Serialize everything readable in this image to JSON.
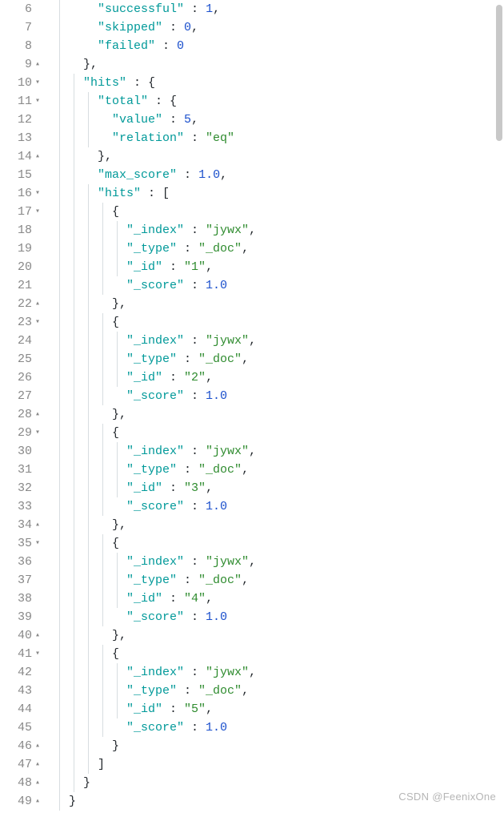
{
  "watermark": "CSDN @FeenixOne",
  "lines": [
    {
      "num": "6",
      "fold": "",
      "indent": 3,
      "parts": [
        [
          "k",
          "\"successful\""
        ],
        [
          "p",
          " : "
        ],
        [
          "n",
          "1"
        ],
        [
          "p",
          ","
        ]
      ]
    },
    {
      "num": "7",
      "fold": "",
      "indent": 3,
      "parts": [
        [
          "k",
          "\"skipped\""
        ],
        [
          "p",
          " : "
        ],
        [
          "n",
          "0"
        ],
        [
          "p",
          ","
        ]
      ]
    },
    {
      "num": "8",
      "fold": "",
      "indent": 3,
      "parts": [
        [
          "k",
          "\"failed\""
        ],
        [
          "p",
          " : "
        ],
        [
          "n",
          "0"
        ]
      ]
    },
    {
      "num": "9",
      "fold": "▴",
      "indent": 2,
      "parts": [
        [
          "p",
          "},"
        ]
      ]
    },
    {
      "num": "10",
      "fold": "▾",
      "indent": 2,
      "parts": [
        [
          "k",
          "\"hits\""
        ],
        [
          "p",
          " : {"
        ]
      ]
    },
    {
      "num": "11",
      "fold": "▾",
      "indent": 3,
      "parts": [
        [
          "k",
          "\"total\""
        ],
        [
          "p",
          " : {"
        ]
      ]
    },
    {
      "num": "12",
      "fold": "",
      "indent": 4,
      "parts": [
        [
          "k",
          "\"value\""
        ],
        [
          "p",
          " : "
        ],
        [
          "n",
          "5"
        ],
        [
          "p",
          ","
        ]
      ]
    },
    {
      "num": "13",
      "fold": "",
      "indent": 4,
      "parts": [
        [
          "k",
          "\"relation\""
        ],
        [
          "p",
          " : "
        ],
        [
          "s",
          "\"eq\""
        ]
      ]
    },
    {
      "num": "14",
      "fold": "▴",
      "indent": 3,
      "parts": [
        [
          "p",
          "},"
        ]
      ]
    },
    {
      "num": "15",
      "fold": "",
      "indent": 3,
      "parts": [
        [
          "k",
          "\"max_score\""
        ],
        [
          "p",
          " : "
        ],
        [
          "n",
          "1.0"
        ],
        [
          "p",
          ","
        ]
      ]
    },
    {
      "num": "16",
      "fold": "▾",
      "indent": 3,
      "parts": [
        [
          "k",
          "\"hits\""
        ],
        [
          "p",
          " : ["
        ]
      ]
    },
    {
      "num": "17",
      "fold": "▾",
      "indent": 4,
      "parts": [
        [
          "p",
          "{"
        ]
      ]
    },
    {
      "num": "18",
      "fold": "",
      "indent": 5,
      "parts": [
        [
          "k",
          "\"_index\""
        ],
        [
          "p",
          " : "
        ],
        [
          "s",
          "\"jywx\""
        ],
        [
          "p",
          ","
        ]
      ]
    },
    {
      "num": "19",
      "fold": "",
      "indent": 5,
      "parts": [
        [
          "k",
          "\"_type\""
        ],
        [
          "p",
          " : "
        ],
        [
          "s",
          "\"_doc\""
        ],
        [
          "p",
          ","
        ]
      ]
    },
    {
      "num": "20",
      "fold": "",
      "indent": 5,
      "parts": [
        [
          "k",
          "\"_id\""
        ],
        [
          "p",
          " : "
        ],
        [
          "s",
          "\"1\""
        ],
        [
          "p",
          ","
        ]
      ]
    },
    {
      "num": "21",
      "fold": "",
      "indent": 5,
      "parts": [
        [
          "k",
          "\"_score\""
        ],
        [
          "p",
          " : "
        ],
        [
          "n",
          "1.0"
        ]
      ]
    },
    {
      "num": "22",
      "fold": "▴",
      "indent": 4,
      "parts": [
        [
          "p",
          "},"
        ]
      ]
    },
    {
      "num": "23",
      "fold": "▾",
      "indent": 4,
      "parts": [
        [
          "p",
          "{"
        ]
      ]
    },
    {
      "num": "24",
      "fold": "",
      "indent": 5,
      "parts": [
        [
          "k",
          "\"_index\""
        ],
        [
          "p",
          " : "
        ],
        [
          "s",
          "\"jywx\""
        ],
        [
          "p",
          ","
        ]
      ]
    },
    {
      "num": "25",
      "fold": "",
      "indent": 5,
      "parts": [
        [
          "k",
          "\"_type\""
        ],
        [
          "p",
          " : "
        ],
        [
          "s",
          "\"_doc\""
        ],
        [
          "p",
          ","
        ]
      ]
    },
    {
      "num": "26",
      "fold": "",
      "indent": 5,
      "parts": [
        [
          "k",
          "\"_id\""
        ],
        [
          "p",
          " : "
        ],
        [
          "s",
          "\"2\""
        ],
        [
          "p",
          ","
        ]
      ]
    },
    {
      "num": "27",
      "fold": "",
      "indent": 5,
      "parts": [
        [
          "k",
          "\"_score\""
        ],
        [
          "p",
          " : "
        ],
        [
          "n",
          "1.0"
        ]
      ]
    },
    {
      "num": "28",
      "fold": "▴",
      "indent": 4,
      "parts": [
        [
          "p",
          "},"
        ]
      ]
    },
    {
      "num": "29",
      "fold": "▾",
      "indent": 4,
      "parts": [
        [
          "p",
          "{"
        ]
      ]
    },
    {
      "num": "30",
      "fold": "",
      "indent": 5,
      "parts": [
        [
          "k",
          "\"_index\""
        ],
        [
          "p",
          " : "
        ],
        [
          "s",
          "\"jywx\""
        ],
        [
          "p",
          ","
        ]
      ]
    },
    {
      "num": "31",
      "fold": "",
      "indent": 5,
      "parts": [
        [
          "k",
          "\"_type\""
        ],
        [
          "p",
          " : "
        ],
        [
          "s",
          "\"_doc\""
        ],
        [
          "p",
          ","
        ]
      ]
    },
    {
      "num": "32",
      "fold": "",
      "indent": 5,
      "parts": [
        [
          "k",
          "\"_id\""
        ],
        [
          "p",
          " : "
        ],
        [
          "s",
          "\"3\""
        ],
        [
          "p",
          ","
        ]
      ]
    },
    {
      "num": "33",
      "fold": "",
      "indent": 5,
      "parts": [
        [
          "k",
          "\"_score\""
        ],
        [
          "p",
          " : "
        ],
        [
          "n",
          "1.0"
        ]
      ]
    },
    {
      "num": "34",
      "fold": "▴",
      "indent": 4,
      "parts": [
        [
          "p",
          "},"
        ]
      ]
    },
    {
      "num": "35",
      "fold": "▾",
      "indent": 4,
      "parts": [
        [
          "p",
          "{"
        ]
      ]
    },
    {
      "num": "36",
      "fold": "",
      "indent": 5,
      "parts": [
        [
          "k",
          "\"_index\""
        ],
        [
          "p",
          " : "
        ],
        [
          "s",
          "\"jywx\""
        ],
        [
          "p",
          ","
        ]
      ]
    },
    {
      "num": "37",
      "fold": "",
      "indent": 5,
      "parts": [
        [
          "k",
          "\"_type\""
        ],
        [
          "p",
          " : "
        ],
        [
          "s",
          "\"_doc\""
        ],
        [
          "p",
          ","
        ]
      ]
    },
    {
      "num": "38",
      "fold": "",
      "indent": 5,
      "parts": [
        [
          "k",
          "\"_id\""
        ],
        [
          "p",
          " : "
        ],
        [
          "s",
          "\"4\""
        ],
        [
          "p",
          ","
        ]
      ]
    },
    {
      "num": "39",
      "fold": "",
      "indent": 5,
      "parts": [
        [
          "k",
          "\"_score\""
        ],
        [
          "p",
          " : "
        ],
        [
          "n",
          "1.0"
        ]
      ]
    },
    {
      "num": "40",
      "fold": "▴",
      "indent": 4,
      "parts": [
        [
          "p",
          "},"
        ]
      ]
    },
    {
      "num": "41",
      "fold": "▾",
      "indent": 4,
      "parts": [
        [
          "p",
          "{"
        ]
      ]
    },
    {
      "num": "42",
      "fold": "",
      "indent": 5,
      "parts": [
        [
          "k",
          "\"_index\""
        ],
        [
          "p",
          " : "
        ],
        [
          "s",
          "\"jywx\""
        ],
        [
          "p",
          ","
        ]
      ]
    },
    {
      "num": "43",
      "fold": "",
      "indent": 5,
      "parts": [
        [
          "k",
          "\"_type\""
        ],
        [
          "p",
          " : "
        ],
        [
          "s",
          "\"_doc\""
        ],
        [
          "p",
          ","
        ]
      ]
    },
    {
      "num": "44",
      "fold": "",
      "indent": 5,
      "parts": [
        [
          "k",
          "\"_id\""
        ],
        [
          "p",
          " : "
        ],
        [
          "s",
          "\"5\""
        ],
        [
          "p",
          ","
        ]
      ]
    },
    {
      "num": "45",
      "fold": "",
      "indent": 5,
      "parts": [
        [
          "k",
          "\"_score\""
        ],
        [
          "p",
          " : "
        ],
        [
          "n",
          "1.0"
        ]
      ]
    },
    {
      "num": "46",
      "fold": "▴",
      "indent": 4,
      "parts": [
        [
          "p",
          "}"
        ]
      ]
    },
    {
      "num": "47",
      "fold": "▴",
      "indent": 3,
      "parts": [
        [
          "p",
          "]"
        ]
      ]
    },
    {
      "num": "48",
      "fold": "▴",
      "indent": 2,
      "parts": [
        [
          "p",
          "}"
        ]
      ]
    },
    {
      "num": "49",
      "fold": "▴",
      "indent": 1,
      "parts": [
        [
          "p",
          "}"
        ]
      ]
    }
  ]
}
